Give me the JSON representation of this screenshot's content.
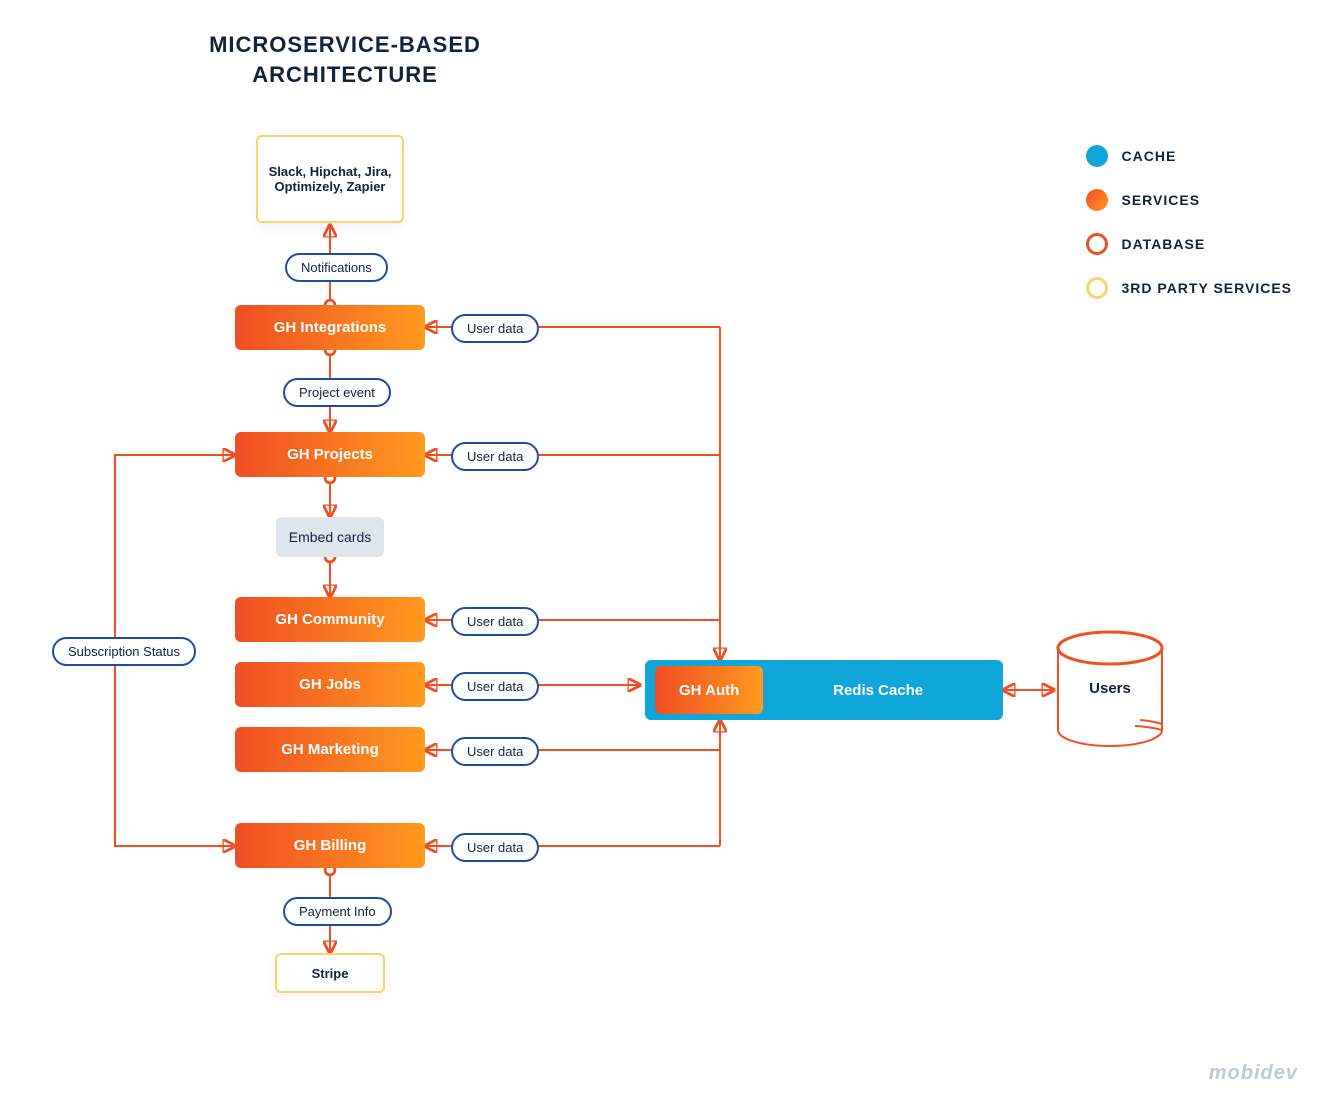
{
  "title_line1": "MICROSERVICE-BASED",
  "title_line2": "ARCHITECTURE",
  "third_party_top": "Slack, Hipchat, Jira, Optimizely, Zapier",
  "services": {
    "integrations": "GH Integrations",
    "projects": "GH Projects",
    "community": "GH Community",
    "jobs": "GH Jobs",
    "marketing": "GH Marketing",
    "billing": "GH Billing",
    "auth": "GH Auth"
  },
  "cache_label": "Redis Cache",
  "gray_box": "Embed cards",
  "third_party_bottom": "Stripe",
  "database": "Users",
  "edges": {
    "notifications": "Notifications",
    "project_event": "Project event",
    "subscription_status": "Subscription Status",
    "payment_info": "Payment Info",
    "user_data": "User data"
  },
  "legend": {
    "cache": "CACHE",
    "services": "SERVICES",
    "database": "DATABASE",
    "third_party": "3RD PARTY SERVICES"
  },
  "brand": "mobidev",
  "colors": {
    "orange_start": "#f04e23",
    "orange_end": "#ff9a1f",
    "cache_blue": "#11a6da",
    "pill_border": "#1e4ca1",
    "third_party_border": "#f5d56b",
    "text_navy": "#14213d"
  }
}
